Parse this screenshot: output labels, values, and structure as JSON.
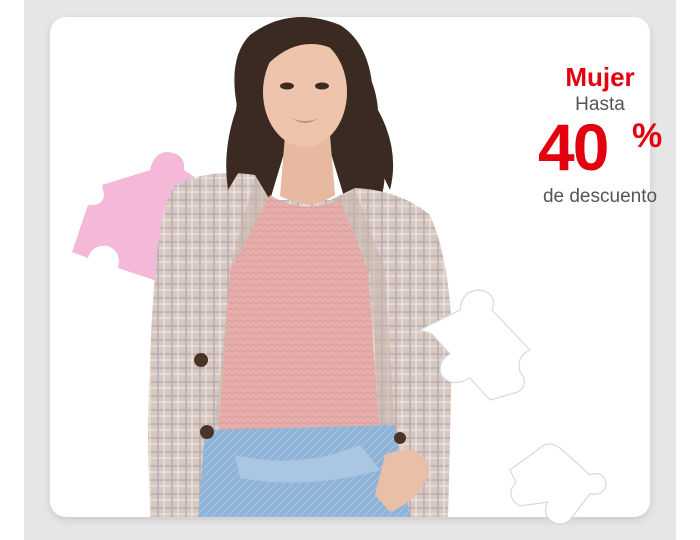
{
  "promo": {
    "title": "Mujer",
    "prefix": "Hasta",
    "discount_number": "40",
    "discount_sign": "%",
    "suffix": "de descuento"
  },
  "icons": [
    "puzzle-piece-icon"
  ],
  "colors": {
    "accent": "#e3000f",
    "text_secondary": "#555555",
    "puzzle_pink": "#f4b8d9",
    "background": "#e6e6e6"
  }
}
